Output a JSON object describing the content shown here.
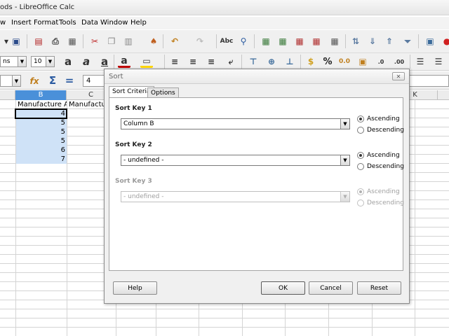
{
  "window": {
    "title": "ods - LibreOffice Calc"
  },
  "menu": [
    "w",
    "Insert",
    "Format",
    "Tools",
    "Data",
    "Window",
    "Help"
  ],
  "toolbar": {
    "font_name": "ns",
    "font_size": "10"
  },
  "formula": {
    "name_box_value": "",
    "input_value": "4"
  },
  "sheet": {
    "columns": [
      "B",
      "C",
      "K"
    ],
    "cells": {
      "b1": "Manufacture A",
      "c1": "Manufacture",
      "b_values": [
        "4",
        "5",
        "5",
        "5",
        "6",
        "7"
      ]
    }
  },
  "dialog": {
    "title": "Sort",
    "close_label": "✕",
    "tabs": [
      "Sort Criteria",
      "Options"
    ],
    "keys": [
      {
        "label": "Sort Key 1",
        "value": "Column B",
        "ascending": "Ascending",
        "descending": "Descending",
        "selected": "ascending",
        "enabled": true
      },
      {
        "label": "Sort Key 2",
        "value": "- undefined -",
        "ascending": "Ascending",
        "descending": "Descending",
        "selected": "ascending",
        "enabled": true
      },
      {
        "label": "Sort Key 3",
        "value": "- undefined -",
        "ascending": "Ascending",
        "descending": "Descending",
        "selected": "ascending",
        "enabled": false
      }
    ],
    "buttons": {
      "help": "Help",
      "ok": "OK",
      "cancel": "Cancel",
      "reset": "Reset"
    }
  },
  "colors": {
    "selection": "#cfe2f7",
    "column_header_selected": "#4a90d9"
  }
}
